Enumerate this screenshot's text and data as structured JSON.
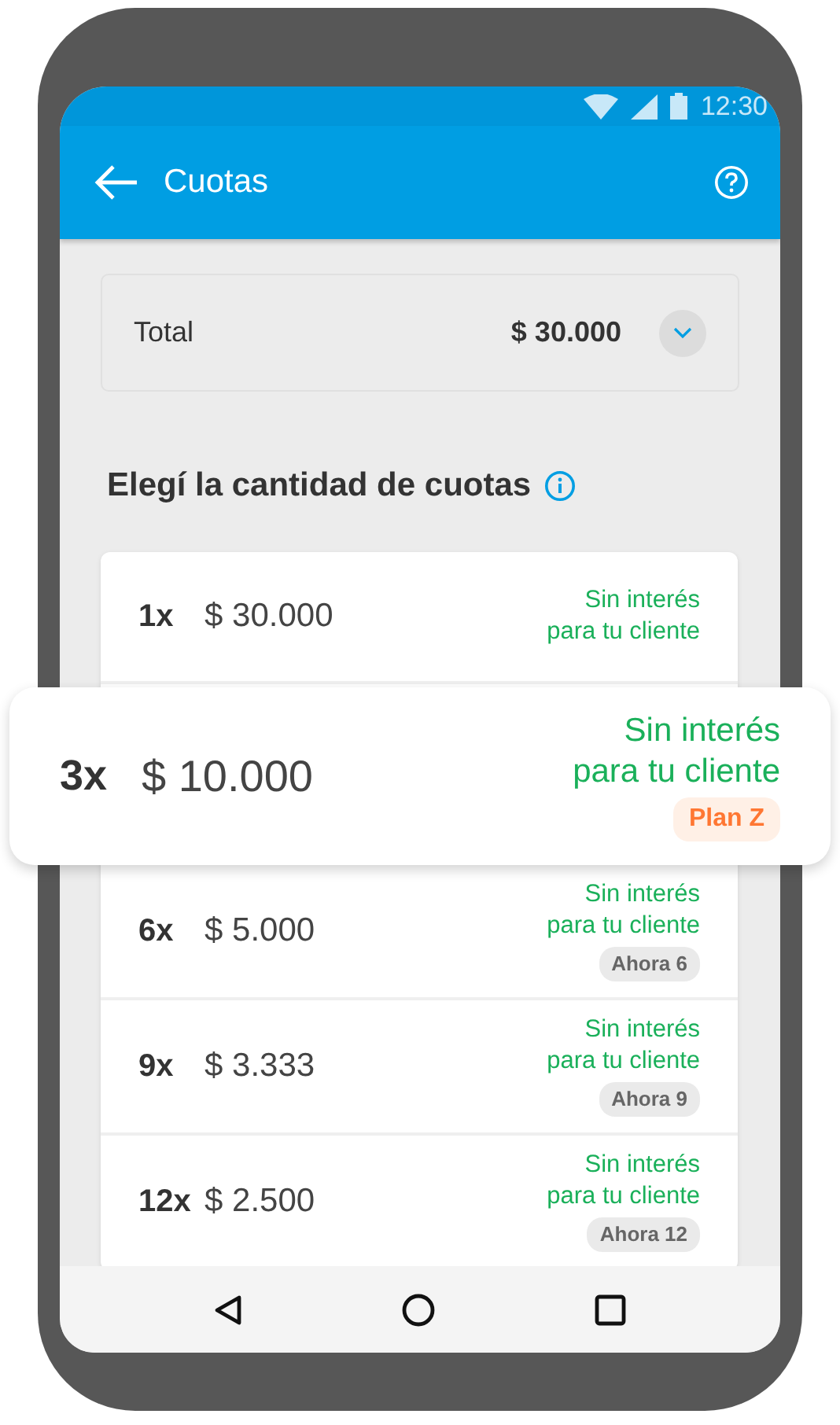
{
  "status_bar": {
    "time": "12:30"
  },
  "app_bar": {
    "title": "Cuotas"
  },
  "total": {
    "label": "Total",
    "amount": "$ 30.000",
    "expanded": false
  },
  "heading": "Elegí la cantidad de cuotas",
  "installments": [
    {
      "count": "1x",
      "amount": "$ 30.000",
      "note": "Sin interés\npara tu cliente",
      "selected": false
    },
    {
      "count": "3x",
      "amount": "$ 10.000",
      "note": "Sin interés\npara tu cliente",
      "badge": {
        "label": "Plan Z",
        "kind": "promo"
      },
      "selected": true
    },
    {
      "count": "6x",
      "amount": "$ 5.000",
      "note": "Sin interés\npara tu cliente",
      "badge": {
        "label": "Ahora 6",
        "kind": "plan"
      },
      "selected": false
    },
    {
      "count": "9x",
      "amount": "$ 3.333",
      "note": "Sin interés\npara tu cliente",
      "badge": {
        "label": "Ahora 9",
        "kind": "plan"
      },
      "selected": false
    },
    {
      "count": "12x",
      "amount": "$ 2.500",
      "note": "Sin interés\npara tu cliente",
      "badge": {
        "label": "Ahora 12",
        "kind": "plan"
      },
      "selected": false
    }
  ]
}
